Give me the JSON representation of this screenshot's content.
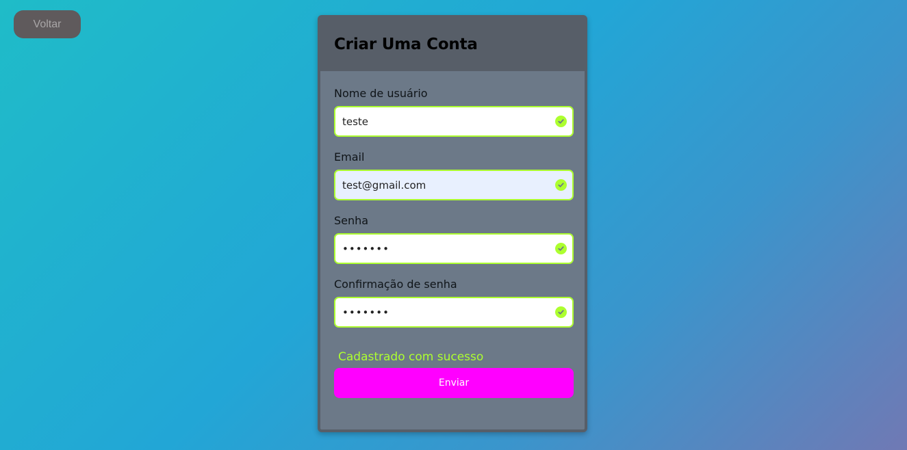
{
  "nav": {
    "back_label": "Voltar"
  },
  "form": {
    "title": "Criar Uma Conta",
    "fields": [
      {
        "label": "Nome de usuário",
        "value": "teste",
        "type": "text"
      },
      {
        "label": "Email",
        "value": "test@gmail.com",
        "type": "email"
      },
      {
        "label": "Senha",
        "value": "1234567",
        "type": "password"
      },
      {
        "label": "Confirmação de senha",
        "value": "1234567",
        "type": "password"
      }
    ],
    "success_message": "Cadastrado com sucesso",
    "submit_label": "Enviar"
  },
  "icons": {
    "valid": "check-circle-icon"
  },
  "colors": {
    "valid_accent": "#adff2f",
    "submit_button": "#ff00ff",
    "card_background": "#6c7988",
    "card_header": "#575e68"
  }
}
